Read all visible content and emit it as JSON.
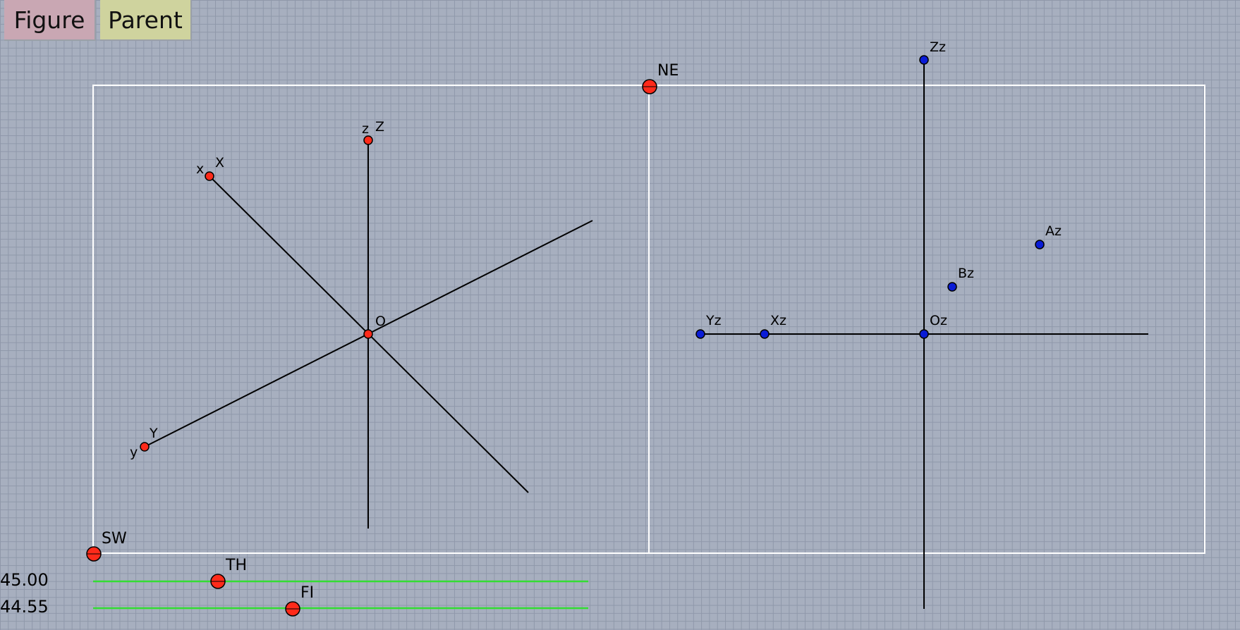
{
  "buttons": {
    "figure_label": "Figure",
    "parent_label": "Parent"
  },
  "colors": {
    "background": "#a7afbf",
    "frame": "#ffffff",
    "axis_line": "#000000",
    "control_point": "#ff2a1a",
    "projection_point": "#0a1cd6",
    "slider_track": "#33dd33"
  },
  "points": {
    "ne": "NE",
    "sw": "SW",
    "o": "O",
    "x_upper": "X",
    "x_lower": "x",
    "y_upper": "Y",
    "y_lower": "y",
    "z_upper": "Z",
    "z_lower": "z",
    "zz": "Zz",
    "az": "Az",
    "bz": "Bz",
    "yz": "Yz",
    "xz": "Xz",
    "oz": "Oz"
  },
  "sliders": {
    "th": {
      "label": "TH",
      "value": "45.00"
    },
    "fi": {
      "label": "FI",
      "value": "44.55"
    }
  }
}
